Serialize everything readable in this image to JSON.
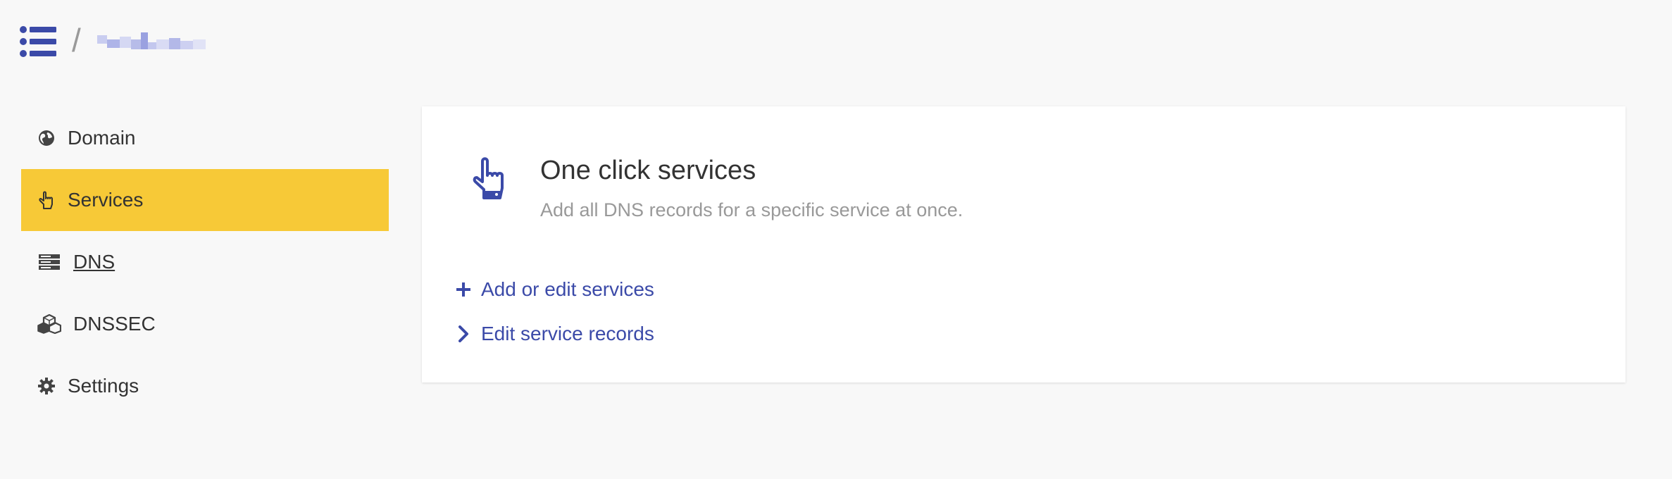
{
  "header": {
    "menu_icon": "list-menu-icon",
    "separator": "/"
  },
  "colors": {
    "accent": "#3b4aa8",
    "active_nav": "#f7c937",
    "background": "#f8f8f8",
    "card": "#ffffff",
    "muted_text": "#999999"
  },
  "sidebar": {
    "items": [
      {
        "label": "Domain",
        "icon": "globe-icon",
        "active": false
      },
      {
        "label": "Services",
        "icon": "pointing-hand-icon",
        "active": true
      },
      {
        "label": "DNS",
        "icon": "server-icon",
        "active": false
      },
      {
        "label": "DNSSEC",
        "icon": "cubes-icon",
        "active": false
      },
      {
        "label": "Settings",
        "icon": "gear-icon",
        "active": false
      }
    ]
  },
  "main": {
    "title": "One click services",
    "subtitle": "Add all DNS records for a specific service at once.",
    "icon": "pointing-hand-icon",
    "actions": [
      {
        "label": "Add or edit services",
        "icon": "plus-icon"
      },
      {
        "label": "Edit service records",
        "icon": "chevron-right-icon"
      }
    ]
  }
}
